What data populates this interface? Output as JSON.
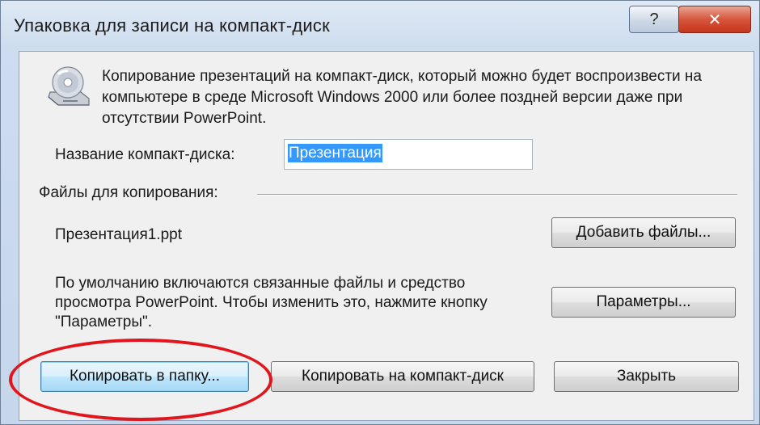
{
  "window": {
    "title": "Упаковка для записи на компакт-диск",
    "help_glyph": "?",
    "close_glyph": "✕"
  },
  "icon": "cd-drive-icon",
  "description": "Копирование презентаций на компакт-диск, который можно будет воспроизвести на компьютере в среде Microsoft Windows 2000 или более поздней версии даже при отсутствии PowerPoint.",
  "cd_name": {
    "label": "Название компакт-диска:",
    "value": "Презентация"
  },
  "files": {
    "group_label": "Файлы для копирования:",
    "items": [
      "Презентация1.ppt"
    ],
    "add_button": "Добавить файлы...",
    "note": "По умолчанию включаются связанные файлы и средство просмотра PowerPoint. Чтобы изменить это, нажмите кнопку \"Параметры\".",
    "options_button": "Параметры..."
  },
  "footer": {
    "copy_folder": "Копировать в папку...",
    "copy_cd": "Копировать на компакт-диск",
    "close": "Закрыть"
  },
  "colors": {
    "highlight_oval": "#e0161c",
    "selection": "#3399ff"
  }
}
